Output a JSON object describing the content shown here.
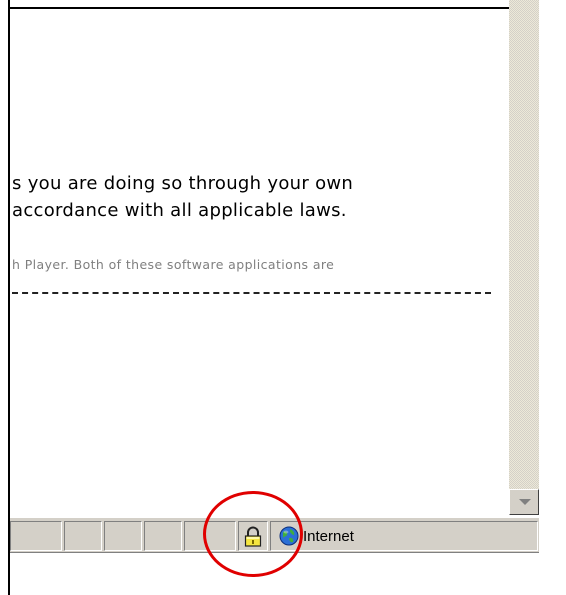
{
  "page": {
    "text_line_1": "s you are doing so through your own",
    "text_line_2": "accordance with all applicable laws.",
    "text_line_3": "h Player. Both of these software applications are"
  },
  "scrollbar": {
    "down_arrow_icon": "scroll-down-arrow-icon"
  },
  "statusbar": {
    "security_icon": "padlock-icon",
    "zone_icon": "globe-icon",
    "zone_label": "Internet"
  },
  "annotation": {
    "highlight_color": "#e00000"
  }
}
